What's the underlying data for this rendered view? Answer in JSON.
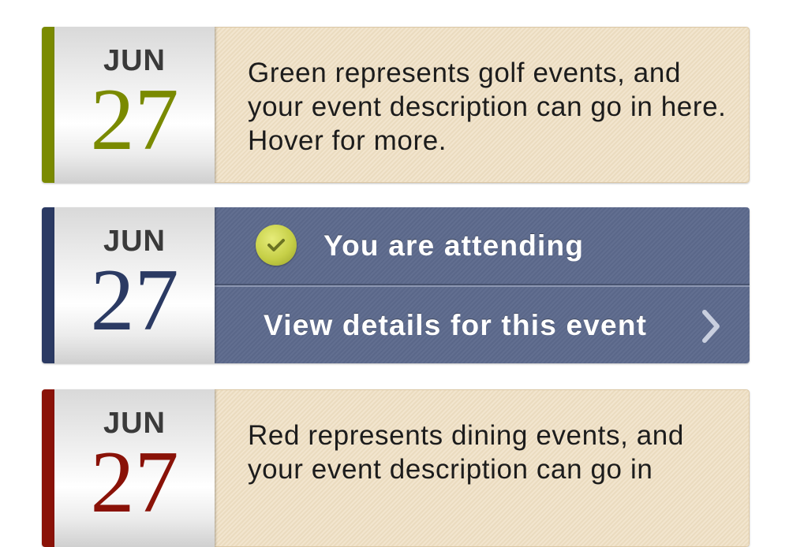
{
  "colors": {
    "golf": "#7a8a00",
    "attending": "#2b3a63",
    "dining": "#8a1208",
    "tan_background": "#efdfc3",
    "blue_background": "#5d6a8d"
  },
  "events": [
    {
      "category": "golf",
      "month": "JUN",
      "day": "27",
      "description": "Green represents golf events, and your event description can go in here. Hover for more."
    },
    {
      "category": "attending",
      "month": "JUN",
      "day": "27",
      "attending_label": "You are attending",
      "details_label": "View details for this event",
      "icons": [
        "check-icon",
        "chevron-right-icon",
        "hand-cursor-icon"
      ]
    },
    {
      "category": "dining",
      "month": "JUN",
      "day": "27",
      "description": "Red represents dining events, and your event description can go in"
    }
  ]
}
